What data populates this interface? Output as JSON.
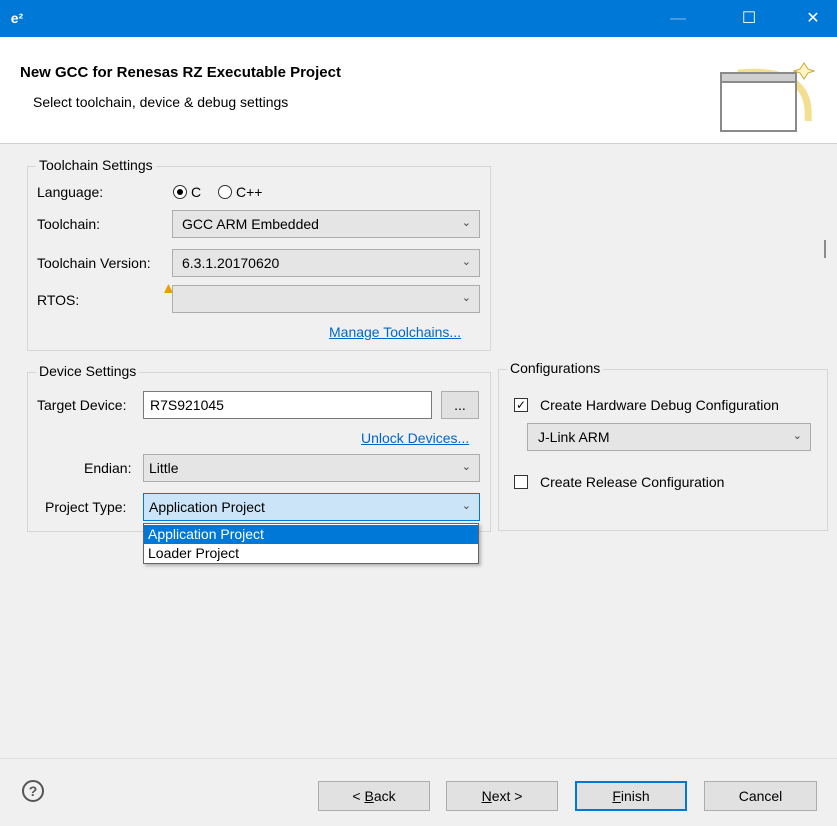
{
  "window": {
    "app_icon_text": "e²",
    "minimize_glyph": "—",
    "maximize_glyph": "☐",
    "close_glyph": "✕"
  },
  "header": {
    "title": "New GCC for Renesas RZ Executable Project",
    "subtitle": "Select toolchain, device & debug settings",
    "graphic_icon": "wizard-new-window-icon"
  },
  "toolchain": {
    "group_title": "Toolchain Settings",
    "language_label": "Language:",
    "lang_c": "C",
    "lang_cpp": "C++",
    "language_selected": "C",
    "toolchain_label": "Toolchain:",
    "toolchain_value": "GCC ARM Embedded",
    "version_label": "Toolchain Version:",
    "version_value": "6.3.1.20170620",
    "rtos_label": "RTOS:",
    "rtos_value": "",
    "manage_link": "Manage Toolchains..."
  },
  "device": {
    "group_title": "Device Settings",
    "target_label": "Target Device:",
    "target_value": "R7S921045",
    "browse_label": "...",
    "unlock_link": "Unlock Devices...",
    "endian_label": "Endian:",
    "endian_value": "Little",
    "project_type_label": "Project Type:",
    "project_type_value": "Application Project",
    "project_type_options": [
      "Application Project",
      "Loader Project"
    ]
  },
  "configurations": {
    "group_title": "Configurations",
    "hw_debug_label": "Create Hardware Debug Configuration",
    "hw_debug_checked": true,
    "debugger_value": "J-Link ARM",
    "release_label": "Create Release Configuration",
    "release_checked": false
  },
  "footer": {
    "help_glyph": "?",
    "back_prefix": "< ",
    "back_mn": "B",
    "back_rest": "ack",
    "next_mn": "N",
    "next_rest": "ext >",
    "finish_mn": "F",
    "finish_rest": "inish",
    "cancel_label": "Cancel"
  },
  "colors": {
    "accent": "#0078d7",
    "link": "#0066cc",
    "warning": "#e8a000"
  }
}
